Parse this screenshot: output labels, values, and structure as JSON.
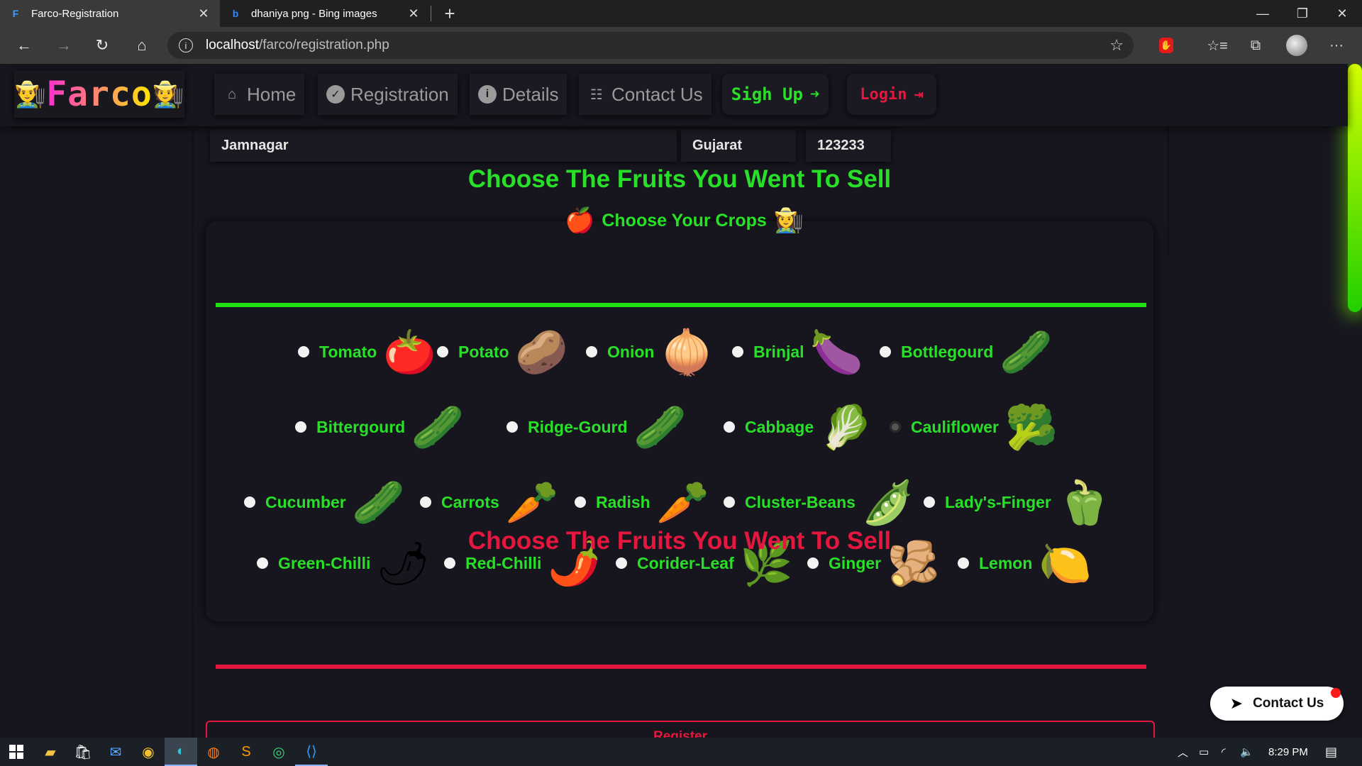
{
  "browser": {
    "tabs": [
      {
        "title": "Farco-Registration",
        "active": true,
        "favicon": "farco-favicon"
      },
      {
        "title": "dhaniya png - Bing images",
        "active": false,
        "favicon": "bing-icon"
      }
    ],
    "url_host": "localhost",
    "url_path": "/farco/registration.php"
  },
  "navbar": {
    "logo_text": "Farco",
    "links": [
      {
        "label": "Home",
        "icon": "home-icon"
      },
      {
        "label": "Registration",
        "icon": "check-circle-icon"
      },
      {
        "label": "Details",
        "icon": "info-circle-icon"
      },
      {
        "label": "Contact Us",
        "icon": "contact-card-icon"
      }
    ],
    "signup_label": "Sigh Up",
    "login_label": "Login"
  },
  "address": {
    "city": "Jamnagar",
    "state": "Gujarat",
    "pincode": "123233"
  },
  "crops_section": {
    "heading": "Choose Your Crops",
    "fruits_title": "Choose The Fruits You Went To Sell",
    "second_title": "Choose The Fruits You Went To Sell",
    "items": [
      {
        "label": "Tomato",
        "icon": "tomato-icon",
        "checked": false
      },
      {
        "label": "Potato",
        "icon": "potato-icon",
        "checked": false
      },
      {
        "label": "Onion",
        "icon": "onion-icon",
        "checked": false
      },
      {
        "label": "Brinjal",
        "icon": "eggplant-icon",
        "checked": false
      },
      {
        "label": "Bottlegourd",
        "icon": "bottlegourd-icon",
        "checked": false
      },
      {
        "label": "Bittergourd",
        "icon": "bittergourd-icon",
        "checked": false
      },
      {
        "label": "Ridge-Gourd",
        "icon": "ridgegourd-icon",
        "checked": false
      },
      {
        "label": "Cabbage",
        "icon": "cabbage-icon",
        "checked": false
      },
      {
        "label": "Cauliflower",
        "icon": "cauliflower-icon",
        "checked": true
      },
      {
        "label": "Cucumber",
        "icon": "cucumber-icon",
        "checked": false
      },
      {
        "label": "Carrots",
        "icon": "carrot-icon",
        "checked": false
      },
      {
        "label": "Radish",
        "icon": "radish-icon",
        "checked": false
      },
      {
        "label": "Cluster-Beans",
        "icon": "beans-icon",
        "checked": false
      },
      {
        "label": "Lady's-Finger",
        "icon": "okra-icon",
        "checked": false
      },
      {
        "label": "Green-Chilli",
        "icon": "green-chilli-icon",
        "checked": false
      },
      {
        "label": "Red-Chilli",
        "icon": "red-chilli-icon",
        "checked": false
      },
      {
        "label": "Corider-Leaf",
        "icon": "coriander-icon",
        "checked": false
      },
      {
        "label": "Ginger",
        "icon": "ginger-icon",
        "checked": false
      },
      {
        "label": "Lemon",
        "icon": "lemon-icon",
        "checked": false
      }
    ]
  },
  "register_label": "Register",
  "floating_contact_label": "Contact Us",
  "taskbar": {
    "clock": "8:29 PM"
  },
  "colors": {
    "accent_green": "#28e028",
    "accent_red": "#e5173f",
    "page_bg": "#17161f"
  }
}
